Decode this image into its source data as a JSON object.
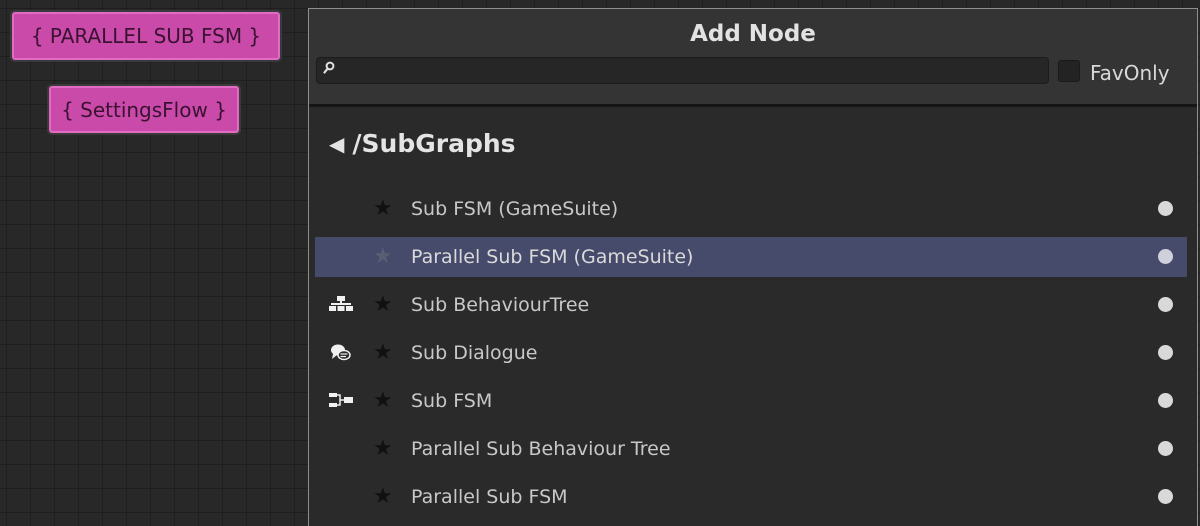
{
  "canvas": {
    "nodes": [
      {
        "label": "{ PARALLEL SUB FSM }",
        "color": "#c94aa8"
      },
      {
        "label": "{ SettingsFlow }",
        "color": "#c94aa8"
      }
    ]
  },
  "panel": {
    "title": "Add Node",
    "search": {
      "value": "",
      "placeholder": ""
    },
    "fav_only_label": "FavOnly",
    "fav_only_checked": false,
    "breadcrumb": {
      "arrow": "◀",
      "path": "/SubGraphs"
    },
    "items": [
      {
        "label": "Sub FSM (GameSuite)",
        "icon": "",
        "selected": false
      },
      {
        "label": "Parallel Sub FSM (GameSuite)",
        "icon": "",
        "selected": true
      },
      {
        "label": "Sub BehaviourTree",
        "icon": "behaviour-tree-icon",
        "selected": false
      },
      {
        "label": "Sub Dialogue",
        "icon": "dialogue-icon",
        "selected": false
      },
      {
        "label": "Sub FSM",
        "icon": "fsm-icon",
        "selected": false
      },
      {
        "label": "Parallel Sub Behaviour Tree",
        "icon": "",
        "selected": false
      },
      {
        "label": "Parallel Sub FSM",
        "icon": "",
        "selected": false
      }
    ],
    "colors": {
      "selected_row": "#464a6b",
      "panel_bg": "#2a2a2a"
    }
  }
}
